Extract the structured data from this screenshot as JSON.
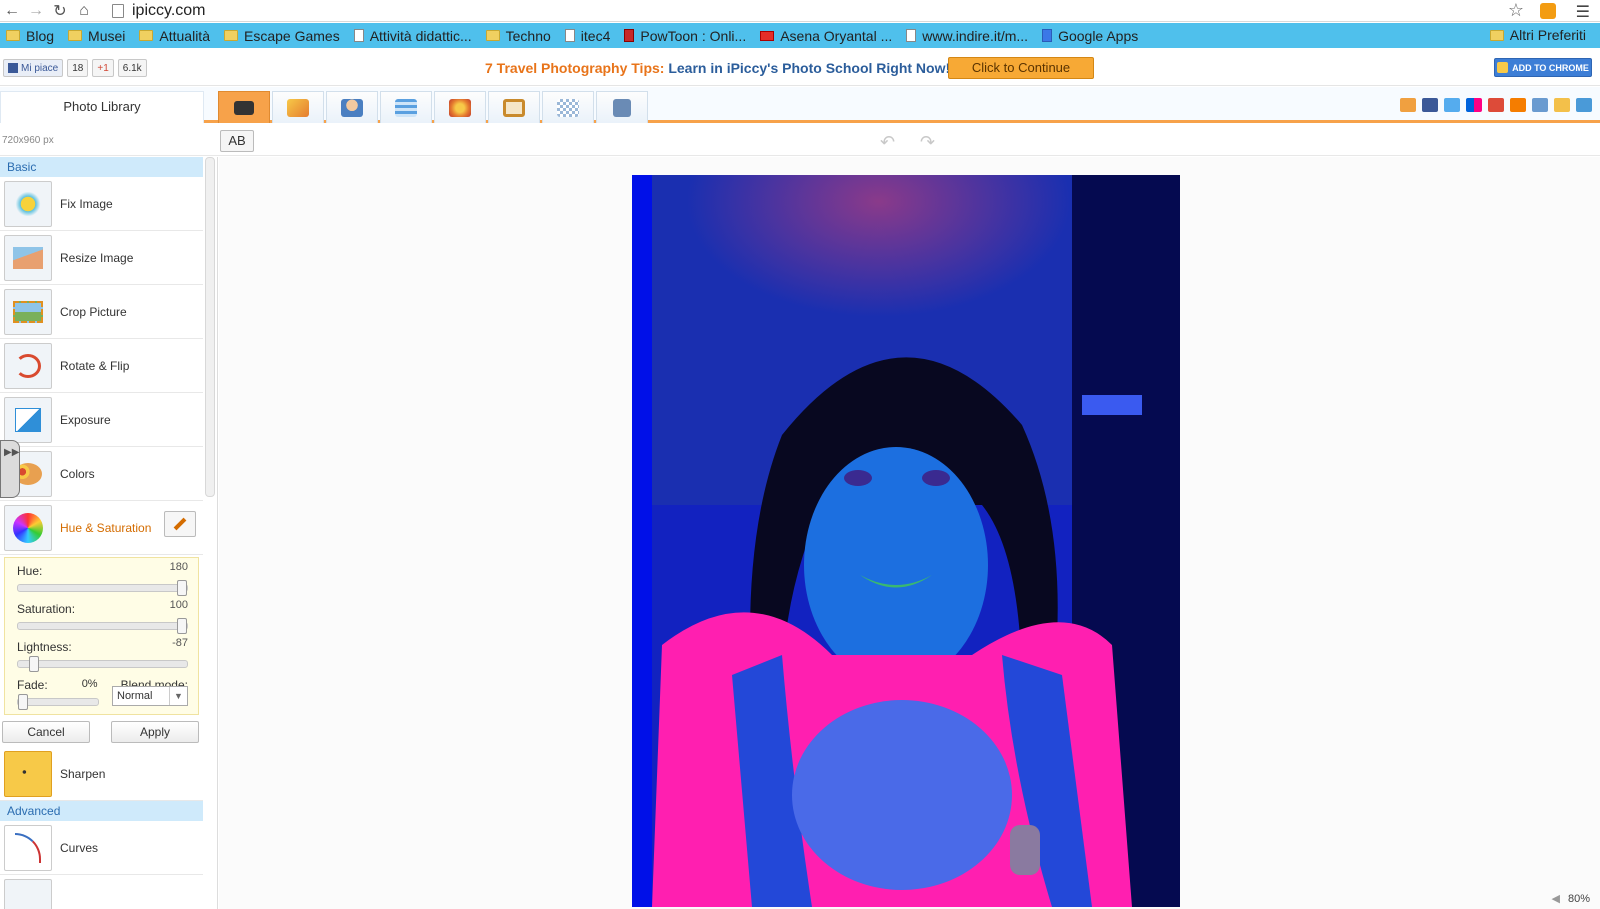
{
  "browser": {
    "url": "ipiccy.com",
    "bookmarks": [
      "Blog",
      "Musei",
      "Attualità",
      "Escape Games",
      "Attività didattic...",
      "Techno",
      "itec4",
      "PowToon : Onli...",
      "Asena Oryantal ...",
      "www.indire.it/m...",
      "Google Apps"
    ],
    "other_bookmarks": "Altri Preferiti"
  },
  "promo": {
    "fb_like": "Mi piace",
    "fb_count": "18",
    "gplus": "+1",
    "share_count": "6.1k",
    "lead": "7 Travel Photography Tips:",
    "text": "Learn in iPiccy's Photo School Right Now!",
    "continue": "Click to Continue",
    "add_chrome": "ADD TO CHROME"
  },
  "toolbar": {
    "library": "Photo Library",
    "tool_icons": [
      "camera-icon",
      "magic-wand-icon",
      "portrait-icon",
      "layers-icon",
      "palette-icon",
      "frame-icon",
      "texture-icon",
      "save-icon"
    ],
    "share_icons": [
      "home-icon",
      "facebook-icon",
      "twitter-icon",
      "flickr-icon",
      "google-icon",
      "blogger-icon",
      "instagram-icon",
      "email-icon",
      "fullscreen-icon"
    ]
  },
  "subbar": {
    "dimensions": "720x960 px",
    "compare": "AB"
  },
  "panel": {
    "basic": "Basic",
    "advanced": "Advanced",
    "items": [
      "Fix Image",
      "Resize Image",
      "Crop Picture",
      "Rotate & Flip",
      "Exposure",
      "Colors",
      "Hue & Saturation",
      "Sharpen",
      "Curves"
    ],
    "hue_label": "Hue:",
    "hue_value": "180",
    "hue_level": 1.0,
    "sat_label": "Saturation:",
    "sat_value": "100",
    "sat_level": 1.0,
    "light_label": "Lightness:",
    "light_value": "-87",
    "light_level": 0.07,
    "fade_label": "Fade:",
    "fade_value": "0%",
    "fade_level": 0.0,
    "blend_label": "Blend mode:",
    "blend_value": "Normal",
    "cancel": "Cancel",
    "apply": "Apply"
  },
  "canvas": {
    "zoom": "80%"
  },
  "colors": {
    "accent_orange": "#f7a24a",
    "bookmark_bar": "#4fc0ec",
    "promo_blue": "#2b5d9b"
  }
}
